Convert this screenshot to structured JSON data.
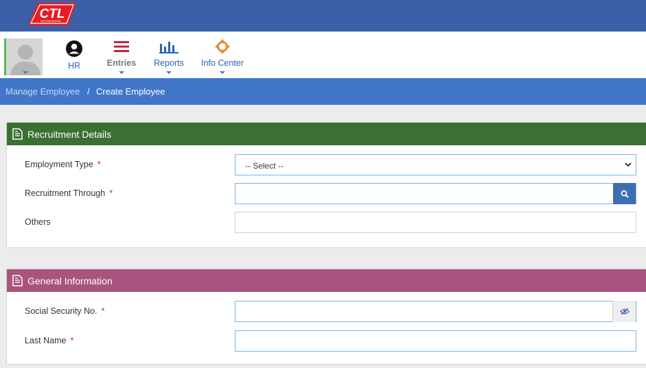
{
  "brand": {
    "logo_text": "CTL",
    "logo_sub": "INFOSERVICES",
    "accent": "#e31e24",
    "topbar_color": "#3d5fa8"
  },
  "nav": {
    "items": [
      {
        "label": "HR",
        "icon": "user-circle-icon"
      },
      {
        "label": "Entries",
        "icon": "hamburger-icon"
      },
      {
        "label": "Reports",
        "icon": "bar-chart-icon"
      },
      {
        "label": "Info Center",
        "icon": "crosshair-icon"
      }
    ]
  },
  "breadcrumb": {
    "parent": "Manage Employee",
    "separator": "/",
    "current": "Create Employee"
  },
  "recruitment": {
    "title": "Recruitment Details",
    "header_color": "#3b7033",
    "employment_type": {
      "label": "Employment Type",
      "required": "*",
      "selected": "-- Select --"
    },
    "recruitment_through": {
      "label": "Recruitment Through",
      "required": "*",
      "value": ""
    },
    "others": {
      "label": "Others",
      "value": ""
    }
  },
  "general": {
    "title": "General Information",
    "header_color": "#a9537f",
    "ssn": {
      "label": "Social Security No.",
      "required": "*",
      "value": ""
    },
    "last_name": {
      "label": "Last Name",
      "required": "*",
      "value": ""
    }
  }
}
